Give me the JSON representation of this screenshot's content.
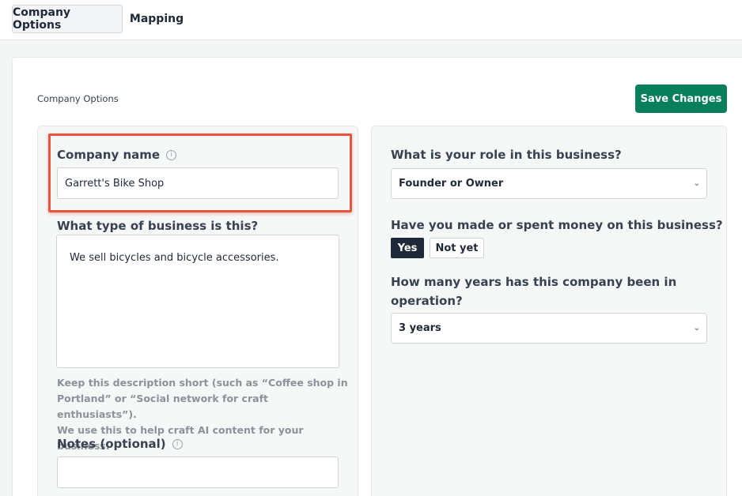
{
  "tabs": [
    {
      "label": "Company Options",
      "active": true
    },
    {
      "label": "Mapping",
      "active": false
    }
  ],
  "section": {
    "label": "Company Options"
  },
  "save_button": {
    "label": "Save Changes",
    "color": "#087f5b"
  },
  "left": {
    "company_name": {
      "label": "Company name",
      "value": "Garrett's Bike Shop",
      "info_icon": "info-circle-icon"
    },
    "business_type": {
      "label": "What type of business is this?",
      "value": "We sell bicycles and bicycle accessories.",
      "help_line1": "Keep this description short (such as “Coffee shop in",
      "help_line2": "Portland” or “Social network for craft enthusiasts”).",
      "help_line3": "We use this to help craft AI content for your business."
    },
    "notes": {
      "label": "Notes (optional)",
      "value": "",
      "info_icon": "info-circle-icon"
    }
  },
  "right": {
    "role": {
      "label": "What is your role in this business?",
      "value": "Founder or Owner"
    },
    "money": {
      "label": "Have you made or spent money on this business?",
      "yes": "Yes",
      "no": "Not yet",
      "selected": "Yes"
    },
    "years": {
      "label_line1": "How many years has this company been in",
      "label_line2": "operation?",
      "value": "3 years"
    }
  },
  "highlight_color": "#e8553e"
}
